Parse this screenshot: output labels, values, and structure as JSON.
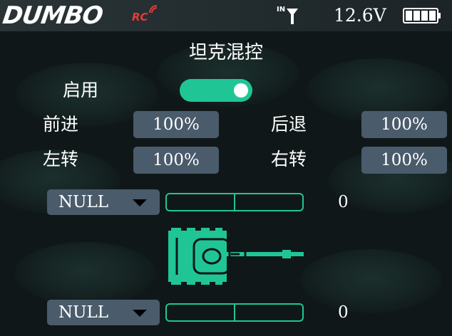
{
  "status_bar": {
    "brand": "DUMBO",
    "brand_sub": "RC",
    "antenna_label": "IN",
    "voltage": "12.6V",
    "battery_level": 1.0
  },
  "page": {
    "title": "坦克混控",
    "enable_label": "启用",
    "enabled": true
  },
  "rates": {
    "forward_label": "前进",
    "forward_value": "100%",
    "backward_label": "后退",
    "backward_value": "100%",
    "left_label": "左转",
    "left_value": "100%",
    "right_label": "右转",
    "right_value": "100%"
  },
  "channels": [
    {
      "source": "NULL",
      "value": "0",
      "level": 0
    },
    {
      "source": "NULL",
      "value": "0",
      "level": 0
    }
  ],
  "colors": {
    "accent": "#20c596",
    "panel": "#4a5b6b",
    "background": "#0f1718",
    "brand_red": "#e83a3a"
  },
  "icons": {
    "antenna": "antenna-icon",
    "battery": "battery-icon",
    "tank": "tank-icon",
    "dropdown": "caret-down-icon"
  }
}
